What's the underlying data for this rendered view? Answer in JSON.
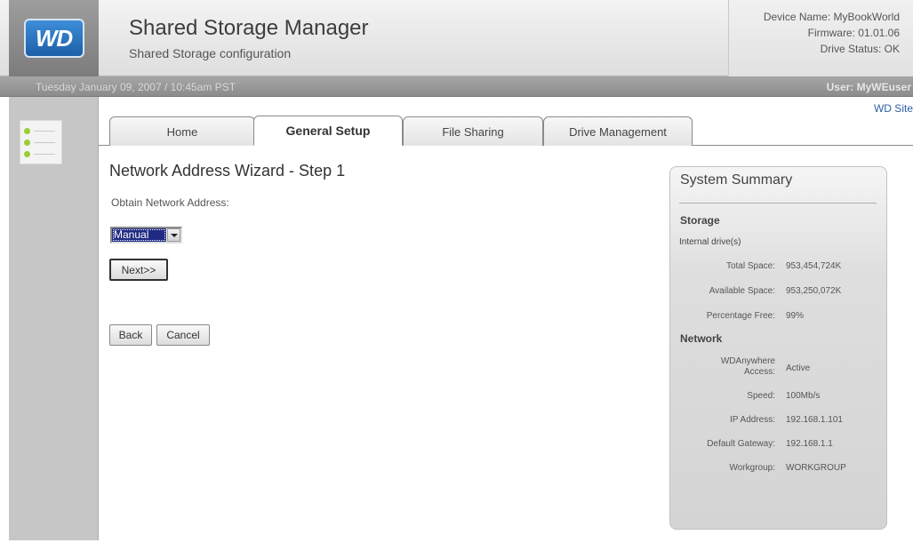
{
  "header": {
    "logo_text": "WD",
    "app_title": "Shared Storage Manager",
    "app_subtitle": "Shared Storage configuration",
    "device_name": "Device Name: MyBookWorld",
    "firmware": "Firmware: 01.01.06",
    "drive_status": "Drive Status: OK"
  },
  "date_bar": {
    "date_text": "Tuesday January 09, 2007 / 10:45am PST",
    "user_text": "User: MyWEuser"
  },
  "nav": {
    "wd_site": "WD Site",
    "tabs": [
      {
        "label": "Home"
      },
      {
        "label": "General Setup"
      },
      {
        "label": "File Sharing"
      },
      {
        "label": "Drive Management"
      }
    ]
  },
  "wizard": {
    "title": "Network Address Wizard - Step 1",
    "field_label": "Obtain Network Address:",
    "select_value": "Manual",
    "next_label": "Next>>",
    "back_label": "Back",
    "cancel_label": "Cancel"
  },
  "summary": {
    "title": "System Summary",
    "storage_heading": "Storage",
    "internal_label": "Internal drive(s)",
    "total_label": "Total Space:",
    "total_value": "953,454,724K",
    "avail_label": "Available Space:",
    "avail_value": "953,250,072K",
    "pct_label": "Percentage Free:",
    "pct_value": "99%",
    "network_heading": "Network",
    "wda_label_1": "WDAnywhere",
    "wda_label_2": "Access:",
    "wda_value": "Active",
    "speed_label": "Speed:",
    "speed_value": "100Mb/s",
    "ip_label": "IP Address:",
    "ip_value": "192.168.1.101",
    "gw_label": "Default Gateway:",
    "gw_value": "192.168.1.1",
    "wg_label": "Workgroup:",
    "wg_value": "WORKGROUP"
  },
  "colors": {
    "select_highlight": "#1f2a82",
    "status_dot": "#9acd32",
    "link": "#2f5fa8"
  }
}
